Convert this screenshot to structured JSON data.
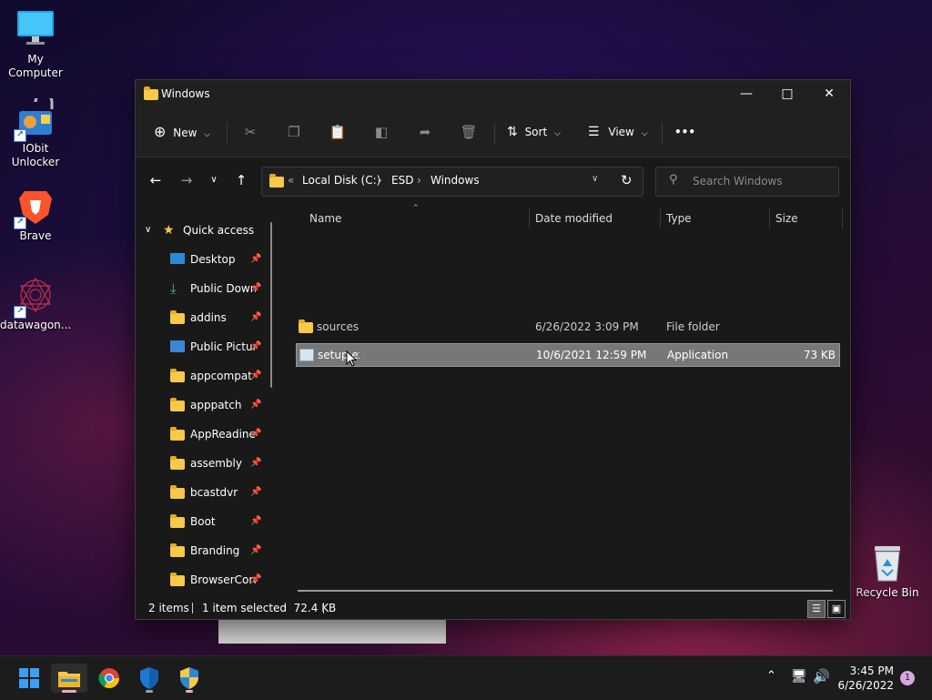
{
  "desktop": {
    "icons": [
      {
        "label": "My Computer"
      },
      {
        "label": "IObit\nUnlocker",
        "line1": "IObit",
        "line2": "Unlocker"
      },
      {
        "label": "Brave"
      },
      {
        "label": "datawagon..."
      },
      {
        "label": "Recycle Bin"
      }
    ]
  },
  "window": {
    "title": "Windows",
    "toolbar": {
      "new_label": "New",
      "sort_label": "Sort",
      "view_label": "View",
      "more_label": "•••"
    },
    "breadcrumb": [
      "Local Disk (C:)",
      "ESD",
      "Windows"
    ],
    "search_placeholder": "Search Windows",
    "sidebar": {
      "quick_access": "Quick access",
      "items": [
        {
          "label": "Desktop"
        },
        {
          "label": "Public Downloads"
        },
        {
          "label": "addins"
        },
        {
          "label": "Public Pictures"
        },
        {
          "label": "appcompat"
        },
        {
          "label": "apppatch"
        },
        {
          "label": "AppReadiness"
        },
        {
          "label": "assembly"
        },
        {
          "label": "bcastdvr"
        },
        {
          "label": "Boot"
        },
        {
          "label": "Branding"
        },
        {
          "label": "BrowserCore"
        }
      ]
    },
    "columns": {
      "name": "Name",
      "date": "Date modified",
      "type": "Type",
      "size": "Size"
    },
    "files": [
      {
        "name": "sources",
        "date": "6/26/2022 3:09 PM",
        "type": "File folder",
        "size": ""
      },
      {
        "name": "setup.exe",
        "date": "10/6/2021 12:59 PM",
        "type": "Application",
        "size": "73 KB"
      }
    ],
    "status": {
      "items": "2 items",
      "selected": "1 item selected  72.4 KB"
    }
  },
  "taskbar": {
    "time": "3:45 PM",
    "date": "6/26/2022",
    "notifications": "1"
  },
  "colors": {
    "accent": "#0078d4",
    "folder": "#f7c948",
    "selection": "#777777"
  }
}
